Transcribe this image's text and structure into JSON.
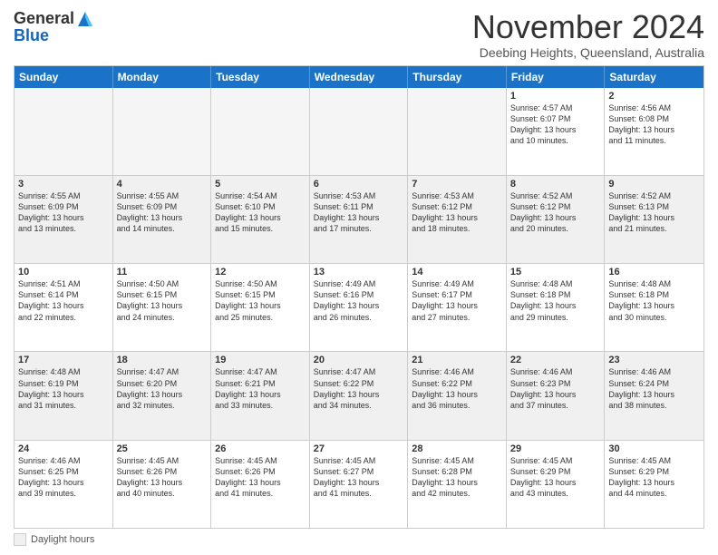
{
  "logo": {
    "general": "General",
    "blue": "Blue"
  },
  "title": "November 2024",
  "location": "Deebing Heights, Queensland, Australia",
  "days_header": [
    "Sunday",
    "Monday",
    "Tuesday",
    "Wednesday",
    "Thursday",
    "Friday",
    "Saturday"
  ],
  "footer_legend": "Daylight hours",
  "weeks": [
    [
      {
        "day": "",
        "detail": "",
        "empty": true
      },
      {
        "day": "",
        "detail": "",
        "empty": true
      },
      {
        "day": "",
        "detail": "",
        "empty": true
      },
      {
        "day": "",
        "detail": "",
        "empty": true
      },
      {
        "day": "",
        "detail": "",
        "empty": true
      },
      {
        "day": "1",
        "detail": "Sunrise: 4:57 AM\nSunset: 6:07 PM\nDaylight: 13 hours\nand 10 minutes."
      },
      {
        "day": "2",
        "detail": "Sunrise: 4:56 AM\nSunset: 6:08 PM\nDaylight: 13 hours\nand 11 minutes."
      }
    ],
    [
      {
        "day": "3",
        "detail": "Sunrise: 4:55 AM\nSunset: 6:09 PM\nDaylight: 13 hours\nand 13 minutes."
      },
      {
        "day": "4",
        "detail": "Sunrise: 4:55 AM\nSunset: 6:09 PM\nDaylight: 13 hours\nand 14 minutes."
      },
      {
        "day": "5",
        "detail": "Sunrise: 4:54 AM\nSunset: 6:10 PM\nDaylight: 13 hours\nand 15 minutes."
      },
      {
        "day": "6",
        "detail": "Sunrise: 4:53 AM\nSunset: 6:11 PM\nDaylight: 13 hours\nand 17 minutes."
      },
      {
        "day": "7",
        "detail": "Sunrise: 4:53 AM\nSunset: 6:12 PM\nDaylight: 13 hours\nand 18 minutes."
      },
      {
        "day": "8",
        "detail": "Sunrise: 4:52 AM\nSunset: 6:12 PM\nDaylight: 13 hours\nand 20 minutes."
      },
      {
        "day": "9",
        "detail": "Sunrise: 4:52 AM\nSunset: 6:13 PM\nDaylight: 13 hours\nand 21 minutes."
      }
    ],
    [
      {
        "day": "10",
        "detail": "Sunrise: 4:51 AM\nSunset: 6:14 PM\nDaylight: 13 hours\nand 22 minutes."
      },
      {
        "day": "11",
        "detail": "Sunrise: 4:50 AM\nSunset: 6:15 PM\nDaylight: 13 hours\nand 24 minutes."
      },
      {
        "day": "12",
        "detail": "Sunrise: 4:50 AM\nSunset: 6:15 PM\nDaylight: 13 hours\nand 25 minutes."
      },
      {
        "day": "13",
        "detail": "Sunrise: 4:49 AM\nSunset: 6:16 PM\nDaylight: 13 hours\nand 26 minutes."
      },
      {
        "day": "14",
        "detail": "Sunrise: 4:49 AM\nSunset: 6:17 PM\nDaylight: 13 hours\nand 27 minutes."
      },
      {
        "day": "15",
        "detail": "Sunrise: 4:48 AM\nSunset: 6:18 PM\nDaylight: 13 hours\nand 29 minutes."
      },
      {
        "day": "16",
        "detail": "Sunrise: 4:48 AM\nSunset: 6:18 PM\nDaylight: 13 hours\nand 30 minutes."
      }
    ],
    [
      {
        "day": "17",
        "detail": "Sunrise: 4:48 AM\nSunset: 6:19 PM\nDaylight: 13 hours\nand 31 minutes."
      },
      {
        "day": "18",
        "detail": "Sunrise: 4:47 AM\nSunset: 6:20 PM\nDaylight: 13 hours\nand 32 minutes."
      },
      {
        "day": "19",
        "detail": "Sunrise: 4:47 AM\nSunset: 6:21 PM\nDaylight: 13 hours\nand 33 minutes."
      },
      {
        "day": "20",
        "detail": "Sunrise: 4:47 AM\nSunset: 6:22 PM\nDaylight: 13 hours\nand 34 minutes."
      },
      {
        "day": "21",
        "detail": "Sunrise: 4:46 AM\nSunset: 6:22 PM\nDaylight: 13 hours\nand 36 minutes."
      },
      {
        "day": "22",
        "detail": "Sunrise: 4:46 AM\nSunset: 6:23 PM\nDaylight: 13 hours\nand 37 minutes."
      },
      {
        "day": "23",
        "detail": "Sunrise: 4:46 AM\nSunset: 6:24 PM\nDaylight: 13 hours\nand 38 minutes."
      }
    ],
    [
      {
        "day": "24",
        "detail": "Sunrise: 4:46 AM\nSunset: 6:25 PM\nDaylight: 13 hours\nand 39 minutes."
      },
      {
        "day": "25",
        "detail": "Sunrise: 4:45 AM\nSunset: 6:26 PM\nDaylight: 13 hours\nand 40 minutes."
      },
      {
        "day": "26",
        "detail": "Sunrise: 4:45 AM\nSunset: 6:26 PM\nDaylight: 13 hours\nand 41 minutes."
      },
      {
        "day": "27",
        "detail": "Sunrise: 4:45 AM\nSunset: 6:27 PM\nDaylight: 13 hours\nand 41 minutes."
      },
      {
        "day": "28",
        "detail": "Sunrise: 4:45 AM\nSunset: 6:28 PM\nDaylight: 13 hours\nand 42 minutes."
      },
      {
        "day": "29",
        "detail": "Sunrise: 4:45 AM\nSunset: 6:29 PM\nDaylight: 13 hours\nand 43 minutes."
      },
      {
        "day": "30",
        "detail": "Sunrise: 4:45 AM\nSunset: 6:29 PM\nDaylight: 13 hours\nand 44 minutes."
      }
    ]
  ]
}
